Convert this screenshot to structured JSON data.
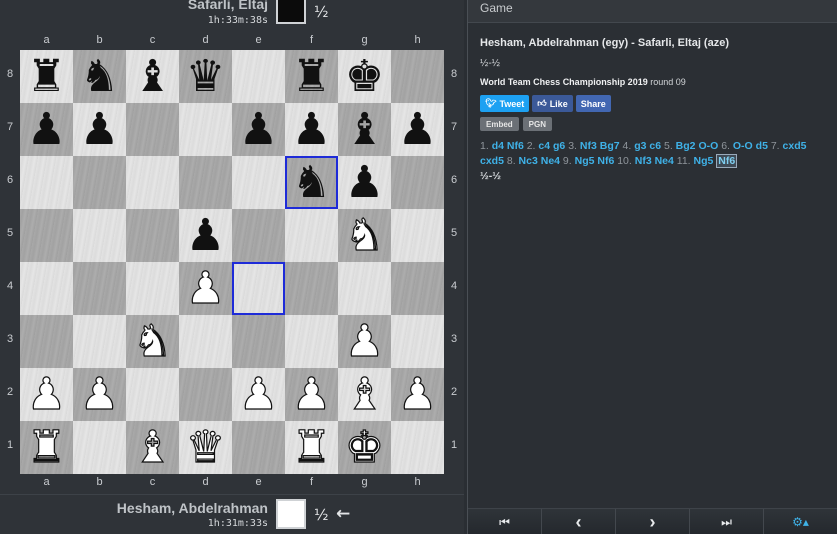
{
  "panel_header": "Game",
  "top_player": {
    "name": "Safarli, Eltaj",
    "clock": "1h:33m:38s",
    "result": "½"
  },
  "bottom_player": {
    "name": "Hesham, Abdelrahman",
    "clock": "1h:31m:33s",
    "result": "½",
    "arrow": "←"
  },
  "files": [
    "a",
    "b",
    "c",
    "d",
    "e",
    "f",
    "g",
    "h"
  ],
  "ranks": [
    "8",
    "7",
    "6",
    "5",
    "4",
    "3",
    "2",
    "1"
  ],
  "board": [
    [
      "bR",
      "bN",
      "bB",
      "bQ",
      "",
      "bR",
      "bK",
      ""
    ],
    [
      "bP",
      "bP",
      "",
      "",
      "bP",
      "bP",
      "bB",
      "bP"
    ],
    [
      "",
      "",
      "",
      "",
      "",
      "bN",
      "bP",
      ""
    ],
    [
      "",
      "",
      "",
      "bP",
      "",
      "",
      "wN",
      ""
    ],
    [
      "",
      "",
      "",
      "wP",
      "",
      "",
      "",
      ""
    ],
    [
      "",
      "",
      "wN",
      "",
      "",
      "",
      "wP",
      ""
    ],
    [
      "wP",
      "wP",
      "",
      "",
      "wP",
      "wP",
      "wB",
      "wP"
    ],
    [
      "wR",
      "",
      "wB",
      "wQ",
      "",
      "wR",
      "wK",
      ""
    ]
  ],
  "piece_glyphs": {
    "K": "♚",
    "Q": "♛",
    "R": "♜",
    "B": "♝",
    "N": "♞",
    "P": "♟"
  },
  "highlighted_squares": [
    "f6",
    "e4"
  ],
  "game": {
    "title": "Hesham, Abdelrahman (egy) - Safarli, Eltaj (aze)",
    "result": "½-½",
    "event": "World Team Chess Championship 2019",
    "round": "round 09"
  },
  "share": {
    "tweet": "Tweet",
    "like": "Like",
    "share": "Share"
  },
  "tools": {
    "embed": "Embed",
    "pgn": "PGN"
  },
  "moves": [
    [
      "1.",
      "d4",
      "Nf6"
    ],
    [
      "2.",
      "c4",
      "g6"
    ],
    [
      "3.",
      "Nf3",
      "Bg7"
    ],
    [
      "4.",
      "g3",
      "c6"
    ],
    [
      "5.",
      "Bg2",
      "O-O"
    ],
    [
      "6.",
      "O-O",
      "d5"
    ],
    [
      "7.",
      "cxd5",
      "cxd5"
    ],
    [
      "8.",
      "Nc3",
      "Ne4"
    ],
    [
      "9.",
      "Ng5",
      "Nf6"
    ],
    [
      "10.",
      "Nf3",
      "Ne4"
    ],
    [
      "11.",
      "Ng5",
      "Nf6"
    ]
  ],
  "final_result": "½-½",
  "nav": {
    "first": "⏮",
    "prev": "‹",
    "next": "›",
    "last": "⏭",
    "settings": "⚙▴"
  }
}
